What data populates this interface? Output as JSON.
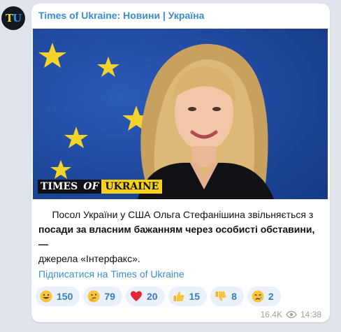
{
  "channel": {
    "name": "Times of Ukraine: Новини | Україна",
    "avatar_letters": [
      "T",
      "U"
    ]
  },
  "photo": {
    "brand": [
      "TIMES",
      "OF",
      "UKRAINE"
    ]
  },
  "message": {
    "line1_plain": "Посол України у США Ольга Стефанішина звільняється з ",
    "bold": "посади за власним бажанням через особисті обставини",
    "after_bold": ", — ",
    "source": "джерела «Інтерфакс»."
  },
  "subscribe_link": "Підписатися на Times of Ukraine",
  "reactions": [
    {
      "emoji": "grinning-face",
      "count": "150"
    },
    {
      "emoji": "thinking-face",
      "count": "79"
    },
    {
      "emoji": "red-heart",
      "count": "20"
    },
    {
      "emoji": "thumbs-up",
      "count": "15"
    },
    {
      "emoji": "thumbs-down",
      "count": "8"
    },
    {
      "emoji": "crying-face",
      "count": "2"
    }
  ],
  "meta": {
    "views": "16.4K",
    "time": "14:38"
  },
  "colors": {
    "link": "#3a8ed4",
    "chip_bg": "#e9f2fb",
    "background": "#dfe5ea"
  }
}
